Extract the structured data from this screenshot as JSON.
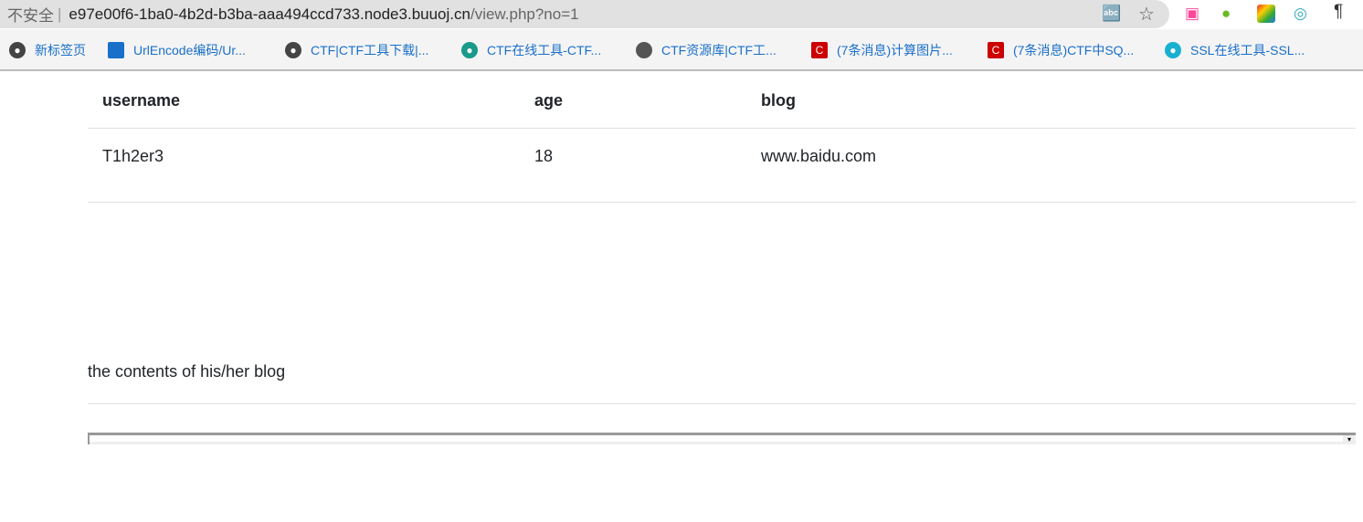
{
  "browser": {
    "security": "不安全",
    "host": "e97e00f6-1ba0-4b2d-b3ba-aaa494ccd733.node3.buuoj.cn",
    "path": "/view.php?no=1"
  },
  "bookmarks": [
    {
      "label": "新标签页",
      "icon": "globe-icon",
      "color": "#444"
    },
    {
      "label": "UrlEncode编码/Ur...",
      "icon": "urlencode-icon",
      "color": "#1a6fc9"
    },
    {
      "label": "CTF|CTF工具下载|...",
      "icon": "globe-icon",
      "color": "#444"
    },
    {
      "label": "CTF在线工具-CTF...",
      "icon": "eye-icon",
      "color": "#1a9a8a"
    },
    {
      "label": "CTF资源库|CTF工...",
      "icon": "spy-icon",
      "color": "#555"
    },
    {
      "label": "(7条消息)计算图片...",
      "icon": "csdn-icon",
      "color": "#c00"
    },
    {
      "label": "(7条消息)CTF中SQ...",
      "icon": "csdn-icon",
      "color": "#c00"
    },
    {
      "label": "SSL在线工具-SSL...",
      "icon": "eye-icon",
      "color": "#1ab0d0"
    }
  ],
  "table": {
    "headers": [
      "username",
      "age",
      "blog"
    ],
    "rows": [
      [
        "T1h2er3",
        "18",
        "www.baidu.com"
      ]
    ]
  },
  "blog_caption": "the contents of his/her blog"
}
